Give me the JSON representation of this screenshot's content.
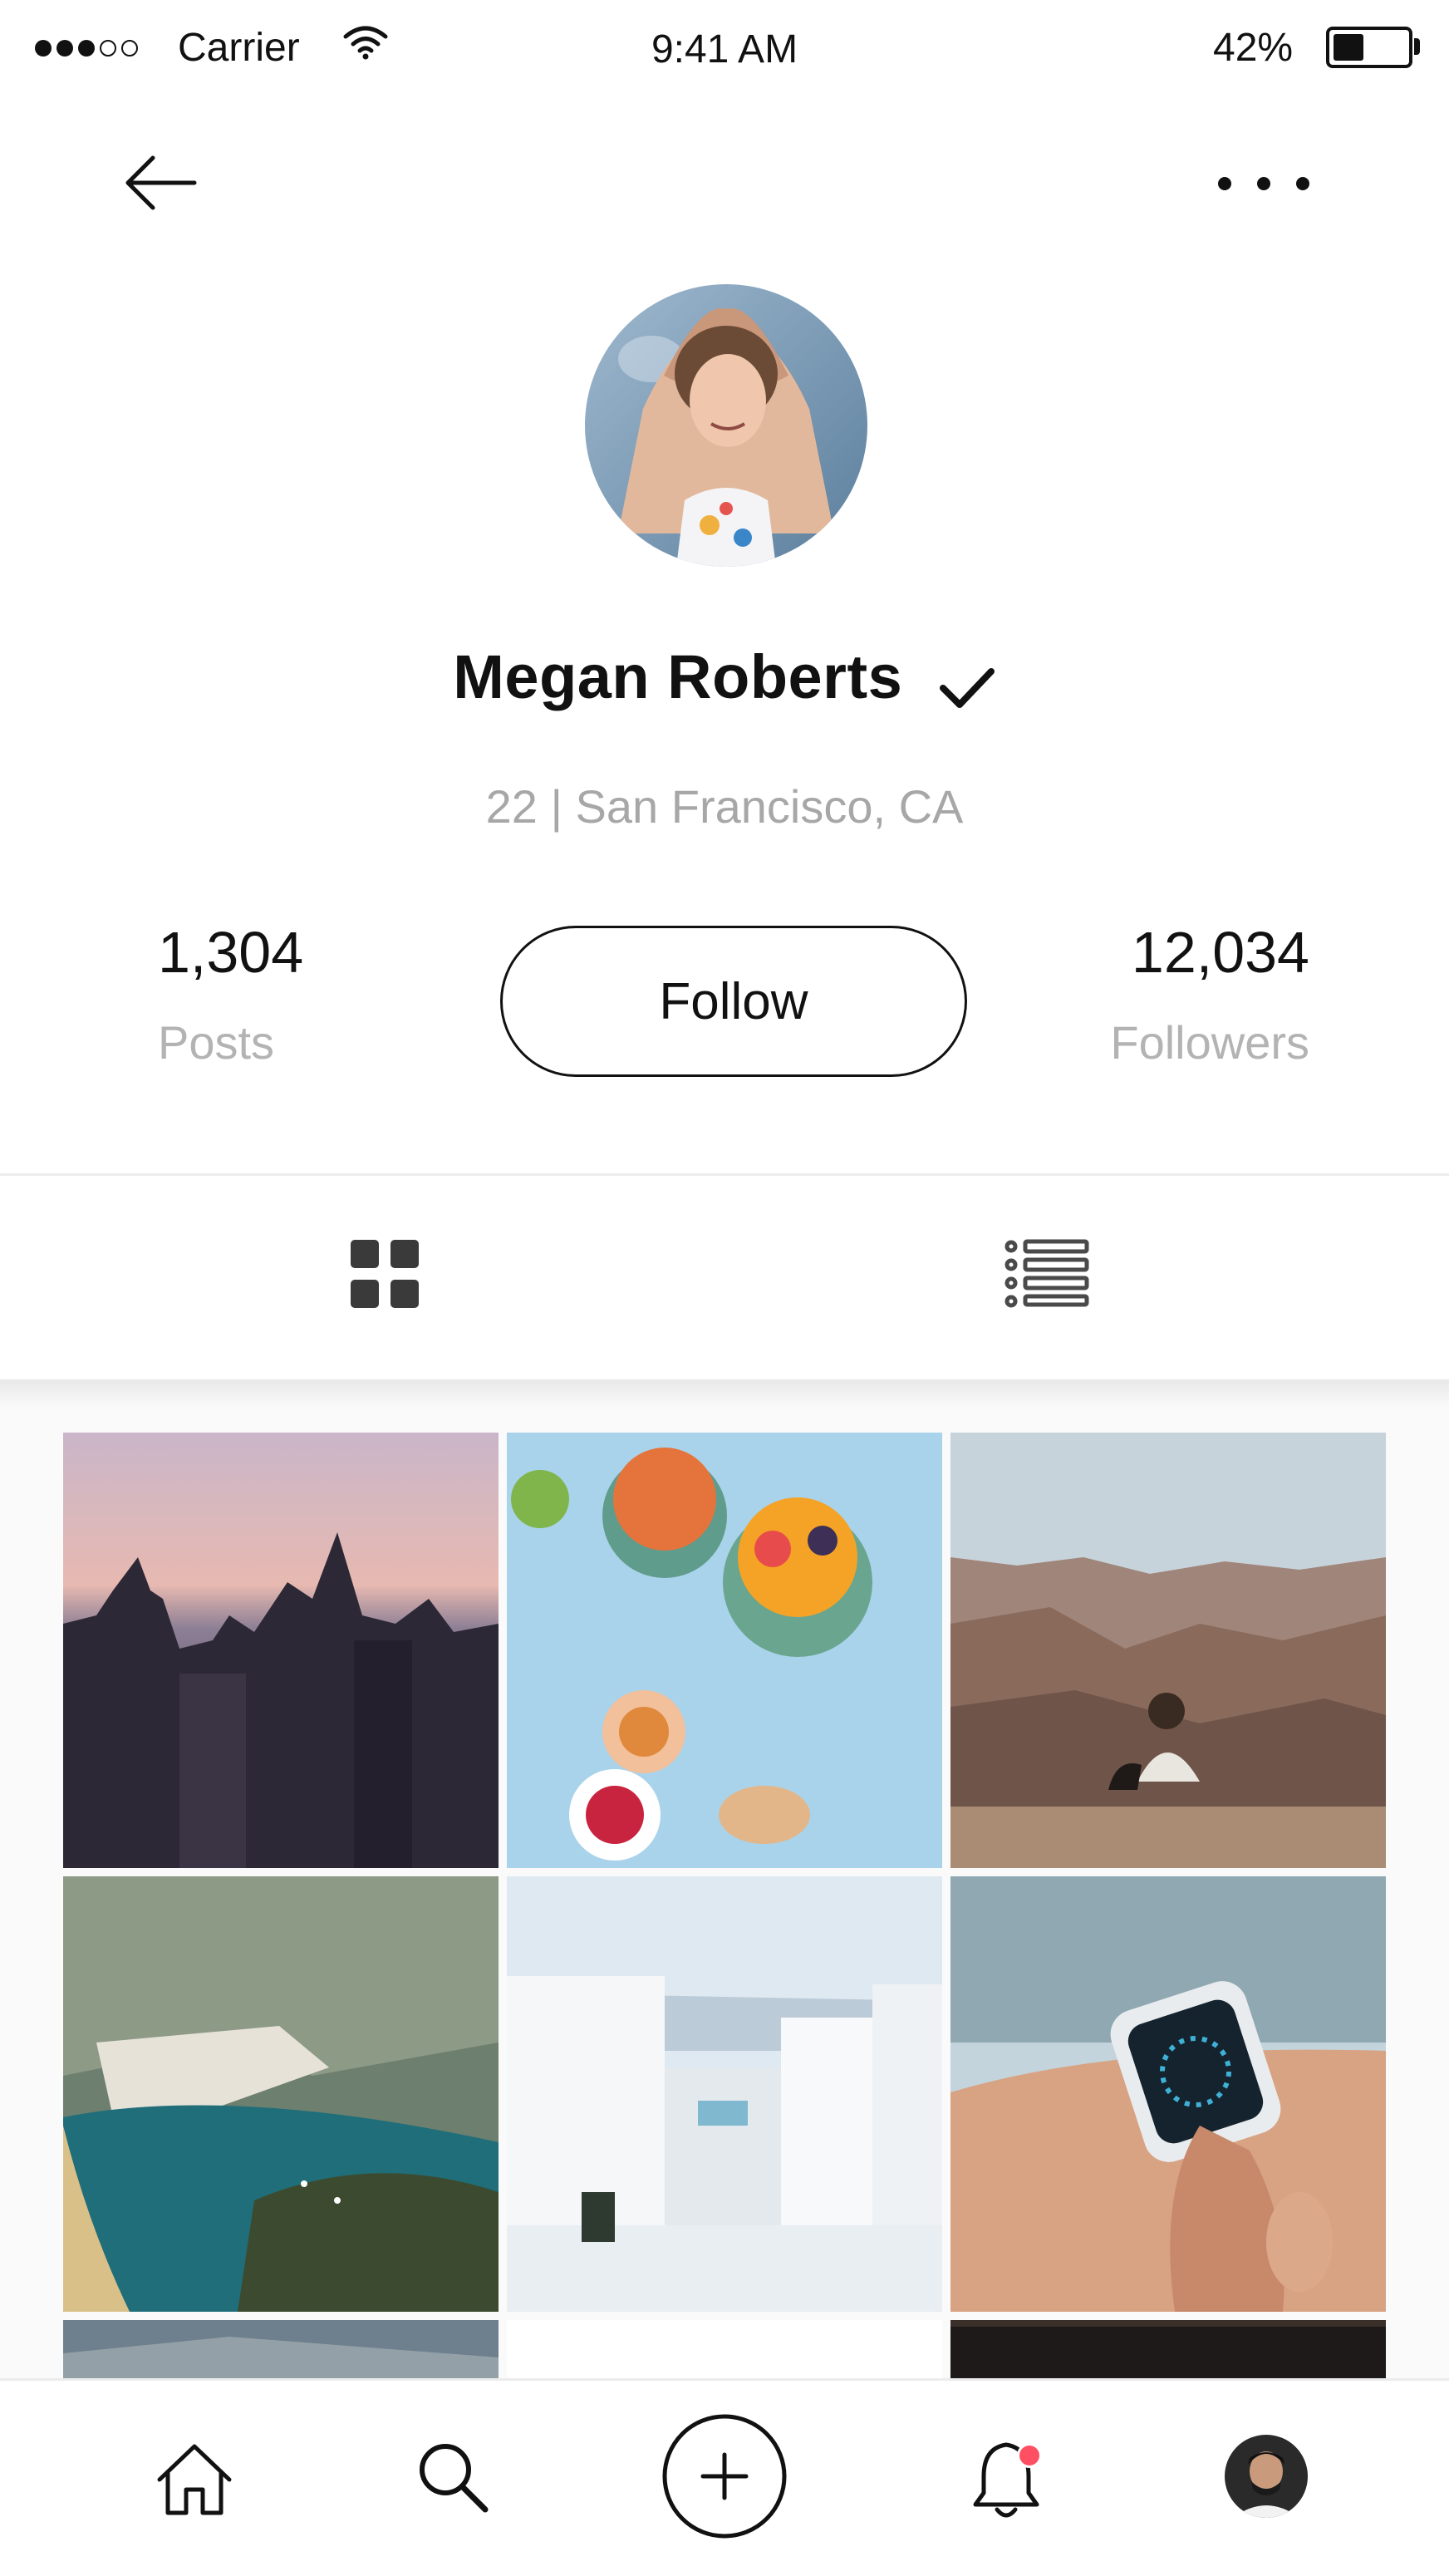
{
  "status_bar": {
    "signal": {
      "filled": 3,
      "empty": 2
    },
    "carrier": "Carrier",
    "time": "9:41 AM",
    "battery": "42%",
    "battery_level": 0.42
  },
  "nav": {
    "back_icon": "arrow-left-icon",
    "more_icon": "more-horizontal-icon"
  },
  "profile": {
    "name": "Megan Roberts",
    "verified_icon": "checkmark-icon",
    "subtitle": "22 | San Francisco, CA",
    "posts_count": "1,304",
    "posts_label": "Posts",
    "followers_count": "12,034",
    "followers_label": "Followers",
    "follow_label": "Follow"
  },
  "view_toggle": {
    "grid_icon": "grid-view-icon",
    "list_icon": "list-view-icon"
  },
  "photos": [
    {
      "subject": "city-skyline"
    },
    {
      "subject": "smoothie-bowls"
    },
    {
      "subject": "canyon-view"
    },
    {
      "subject": "coastal-bay"
    },
    {
      "subject": "white-buildings"
    },
    {
      "subject": "smartwatch"
    },
    {
      "subject": "partial-landscape"
    },
    {
      "subject": "partial-white"
    },
    {
      "subject": "partial-dark"
    }
  ],
  "tabbar": {
    "items": [
      "home-icon",
      "search-icon",
      "add-icon",
      "notifications-icon",
      "profile-avatar"
    ],
    "notification_badge": true
  },
  "colors": {
    "text": "#111111",
    "muted": "#a7a7a7",
    "badge": "#ff4f63",
    "divider": "#ececec"
  }
}
